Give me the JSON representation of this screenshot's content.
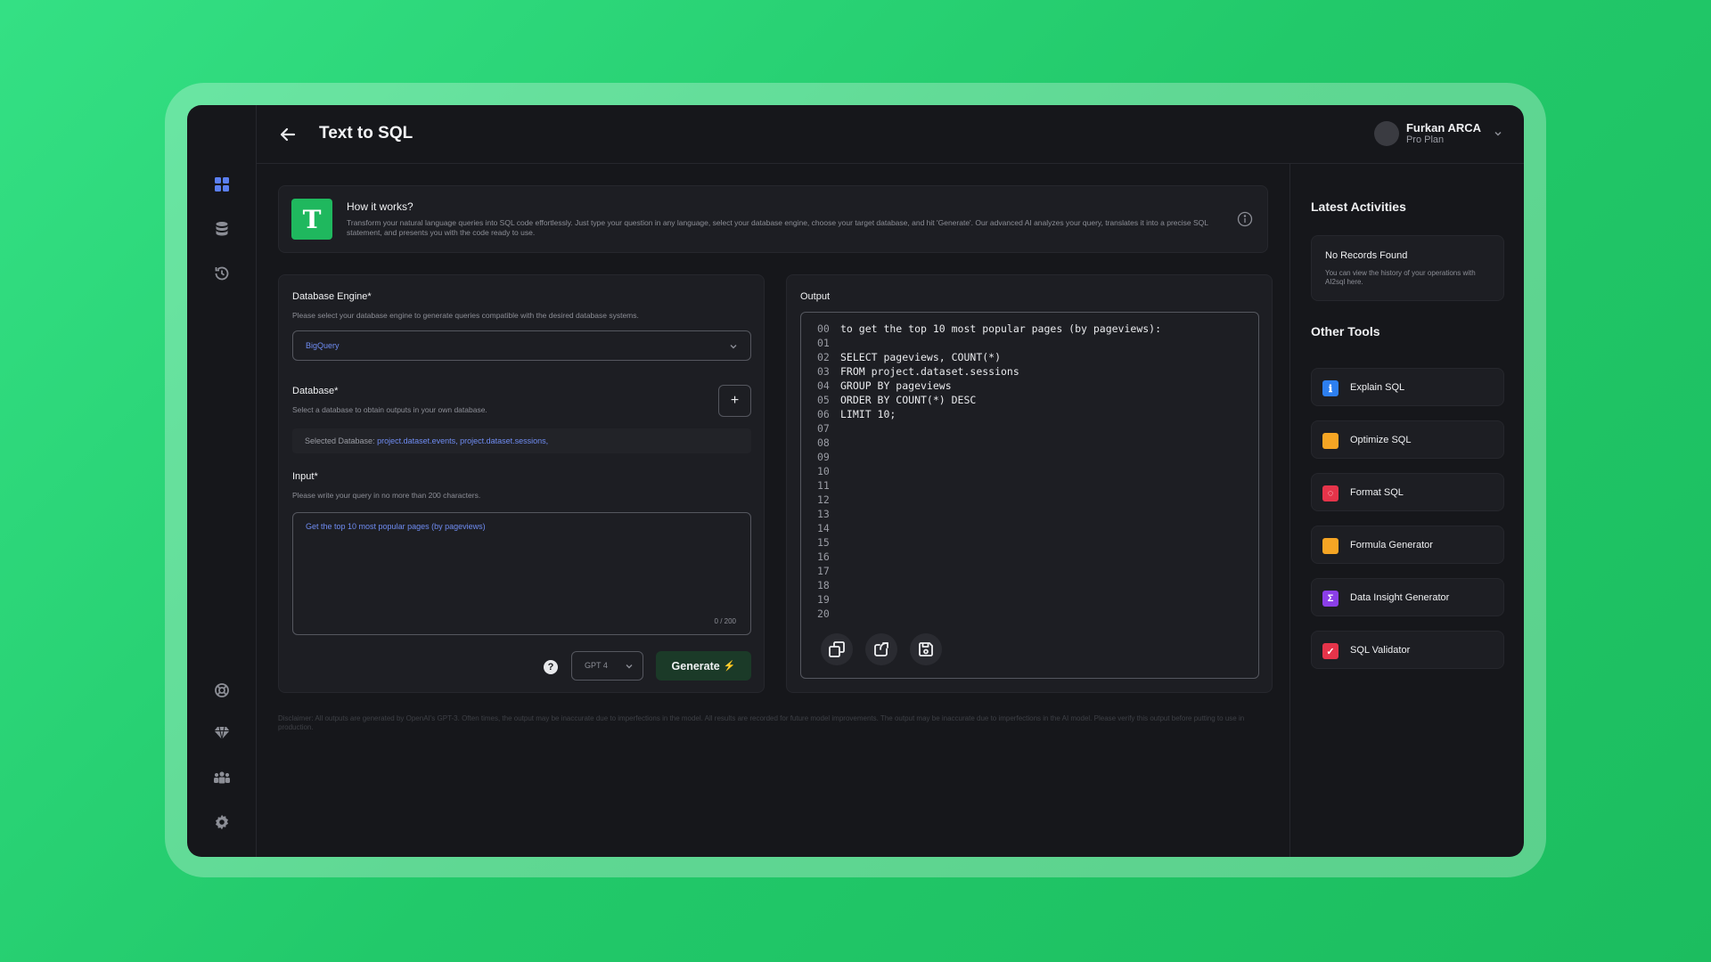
{
  "header": {
    "title": "Text to SQL",
    "user_name": "Furkan ARCA",
    "user_plan": "Pro Plan"
  },
  "how_it_works": {
    "logo_letter": "T",
    "title": "How it works?",
    "text": "Transform your natural language queries into SQL code effortlessly. Just type your question in any language, select your database engine, choose your target database, and hit 'Generate'. Our advanced AI analyzes your query, translates it into a precise SQL statement, and presents you with the code ready to use."
  },
  "form": {
    "engine_label": "Database Engine*",
    "engine_help": "Please select your database engine to generate queries compatible with the desired database systems.",
    "engine_value": "BigQuery",
    "database_label": "Database*",
    "database_help": "Select a database to obtain outputs in your own database.",
    "add_label": "+",
    "selected_prefix": "Selected Database:",
    "selected_dbs": "project.dataset.events, project.dataset.sessions,",
    "input_label": "Input*",
    "input_help": "Please write your query in no more than 200 characters.",
    "input_value": "Get the top 10 most popular pages (by pageviews)",
    "char_count": "0 / 200",
    "help_label": "?",
    "model_value": "GPT 4",
    "generate_label": "Generate",
    "generate_icon": "⚡"
  },
  "output": {
    "label": "Output",
    "lines": [
      {
        "n": "00",
        "code": "to get the top 10 most popular pages (by pageviews):"
      },
      {
        "n": "01",
        "code": ""
      },
      {
        "n": "02",
        "code": "SELECT pageviews, COUNT(*)"
      },
      {
        "n": "03",
        "code": "FROM project.dataset.sessions"
      },
      {
        "n": "04",
        "code": "GROUP BY pageviews"
      },
      {
        "n": "05",
        "code": "ORDER BY COUNT(*) DESC"
      },
      {
        "n": "06",
        "code": "LIMIT 10;"
      },
      {
        "n": "07",
        "code": ""
      },
      {
        "n": "08",
        "code": ""
      },
      {
        "n": "09",
        "code": ""
      },
      {
        "n": "10",
        "code": ""
      },
      {
        "n": "11",
        "code": ""
      },
      {
        "n": "12",
        "code": ""
      },
      {
        "n": "13",
        "code": ""
      },
      {
        "n": "14",
        "code": ""
      },
      {
        "n": "15",
        "code": ""
      },
      {
        "n": "16",
        "code": ""
      },
      {
        "n": "17",
        "code": ""
      },
      {
        "n": "18",
        "code": ""
      },
      {
        "n": "19",
        "code": ""
      },
      {
        "n": "20",
        "code": ""
      }
    ]
  },
  "disclaimer": "Disclaimer: All outputs are generated by OpenAI's GPT-3. Often times, the output may be inaccurate due to imperfections in the model. All results are recorded for future model improvements. The output may be inaccurate due to imperfections in the AI model. Please verify this output before putting to use in production.",
  "latest": {
    "title": "Latest Activities",
    "empty_title": "No Records Found",
    "empty_text": "You can view the history of your operations with AI2sql here."
  },
  "tools": {
    "title": "Other Tools",
    "items": [
      {
        "label": "Explain SQL",
        "icon": "explain-icon",
        "color": "#2d7ff0",
        "glyph": "ℹ"
      },
      {
        "label": "Optimize SQL",
        "icon": "optimize-icon",
        "color": "#f5a524",
        "glyph": ""
      },
      {
        "label": "Format SQL",
        "icon": "format-icon",
        "color": "#e5344a",
        "glyph": "◌"
      },
      {
        "label": "Formula Generator",
        "icon": "formula-icon",
        "color": "#f5a524",
        "glyph": ""
      },
      {
        "label": "Data Insight Generator",
        "icon": "insight-icon",
        "color": "#8b3fe8",
        "glyph": "Σ"
      },
      {
        "label": "SQL Validator",
        "icon": "validator-icon",
        "color": "#e5344a",
        "glyph": "✓"
      }
    ]
  },
  "colors": {
    "accent_blue": "#6f8cf2",
    "accent_green": "#1fb85e",
    "app_bg": "#16171b"
  }
}
